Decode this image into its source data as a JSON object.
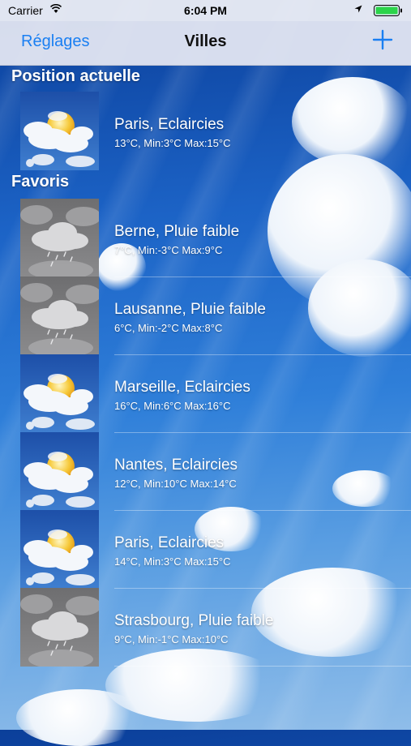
{
  "status_bar": {
    "carrier": "Carrier",
    "time": "6:04 PM"
  },
  "nav": {
    "back_label": "Réglages",
    "title": "Villes"
  },
  "sections": {
    "current": {
      "title": "Position actuelle",
      "items": [
        {
          "city": "Paris, Eclaircies",
          "temps": "13°C, Min:3°C Max:15°C",
          "icon": "partly-cloudy-sun-icon"
        }
      ]
    },
    "favorites": {
      "title": "Favoris",
      "items": [
        {
          "city": "Berne, Pluie faible",
          "temps": "7°C, Min:-3°C Max:9°C",
          "icon": "light-rain-icon"
        },
        {
          "city": "Lausanne, Pluie faible",
          "temps": "6°C, Min:-2°C Max:8°C",
          "icon": "light-rain-icon"
        },
        {
          "city": "Marseille, Eclaircies",
          "temps": "16°C, Min:6°C Max:16°C",
          "icon": "partly-cloudy-sun-icon"
        },
        {
          "city": "Nantes, Eclaircies",
          "temps": "12°C, Min:10°C Max:14°C",
          "icon": "partly-cloudy-sun-icon"
        },
        {
          "city": "Paris, Eclaircies",
          "temps": "14°C, Min:3°C Max:15°C",
          "icon": "partly-cloudy-sun-icon"
        },
        {
          "city": "Strasbourg, Pluie faible",
          "temps": "9°C, Min:-1°C Max:10°C",
          "icon": "light-rain-icon"
        }
      ]
    }
  },
  "colors": {
    "accent": "#1a7ff2",
    "sky_top": "#0b3f9a",
    "sky_bottom": "#8fbde9"
  }
}
